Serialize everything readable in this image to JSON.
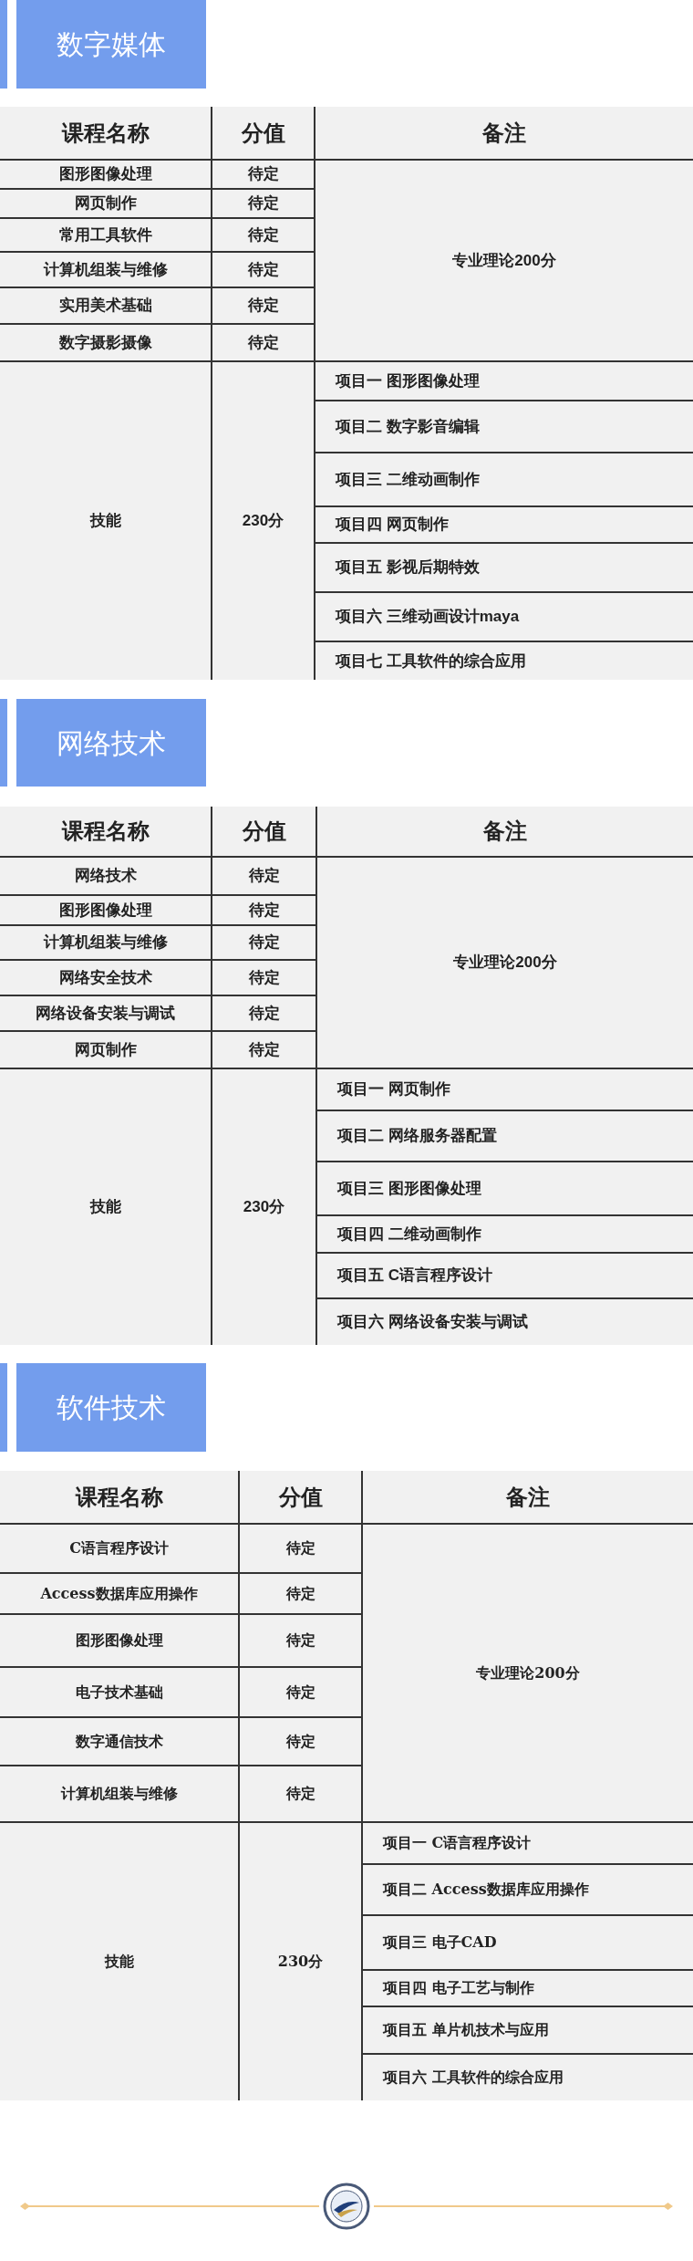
{
  "sections": [
    {
      "title": "数字媒体",
      "columns": [
        "课程名称",
        "分值",
        "备注"
      ],
      "theory_courses": [
        {
          "name": "图形图像处理",
          "score": "待定"
        },
        {
          "name": "网页制作",
          "score": "待定"
        },
        {
          "name": "常用工具软件",
          "score": "待定"
        },
        {
          "name": "计算机组装与维修",
          "score": "待定"
        },
        {
          "name": "实用美术基础",
          "score": "待定"
        },
        {
          "name": "数字摄影摄像",
          "score": "待定"
        }
      ],
      "theory_note": "专业理论200分",
      "skill_label": "技能",
      "skill_score": "230分",
      "skill_projects": [
        "项目一 图形图像处理",
        "项目二 数字影音编辑",
        "项目三 二维动画制作",
        "项目四 网页制作",
        "项目五 影视后期特效",
        "项目六 三维动画设计maya",
        "项目七 工具软件的综合应用"
      ]
    },
    {
      "title": "网络技术",
      "columns": [
        "课程名称",
        "分值",
        "备注"
      ],
      "theory_courses": [
        {
          "name": "网络技术",
          "score": "待定"
        },
        {
          "name": "图形图像处理",
          "score": "待定"
        },
        {
          "name": "计算机组装与维修",
          "score": "待定"
        },
        {
          "name": "网络安全技术",
          "score": "待定"
        },
        {
          "name": "网络设备安装与调试",
          "score": "待定"
        },
        {
          "name": "网页制作",
          "score": "待定"
        }
      ],
      "theory_note": "专业理论200分",
      "skill_label": "技能",
      "skill_score": "230分",
      "skill_projects": [
        "项目一 网页制作",
        "项目二 网络服务器配置",
        "项目三 图形图像处理",
        "项目四 二维动画制作",
        "项目五 C语言程序设计",
        "项目六 网络设备安装与调试"
      ]
    },
    {
      "title": "软件技术",
      "columns": [
        "课程名称",
        "分值",
        "备注"
      ],
      "theory_courses": [
        {
          "name": "C语言程序设计",
          "score": "待定"
        },
        {
          "name": "Access数据库应用操作",
          "score": "待定"
        },
        {
          "name": "图形图像处理",
          "score": "待定"
        },
        {
          "name": "电子技术基础",
          "score": "待定"
        },
        {
          "name": "数字通信技术",
          "score": "待定"
        },
        {
          "name": "计算机组装与维修",
          "score": "待定"
        }
      ],
      "theory_note": "专业理论200分",
      "skill_label": "技能",
      "skill_score": "230分",
      "skill_projects": [
        "项目一 C语言程序设计",
        "项目二 Access数据库应用操作",
        "项目三 电子CAD",
        "项目四 电子工艺与制作",
        "项目五 单片机技术与应用",
        "项目六 工具软件的综合应用"
      ]
    }
  ]
}
